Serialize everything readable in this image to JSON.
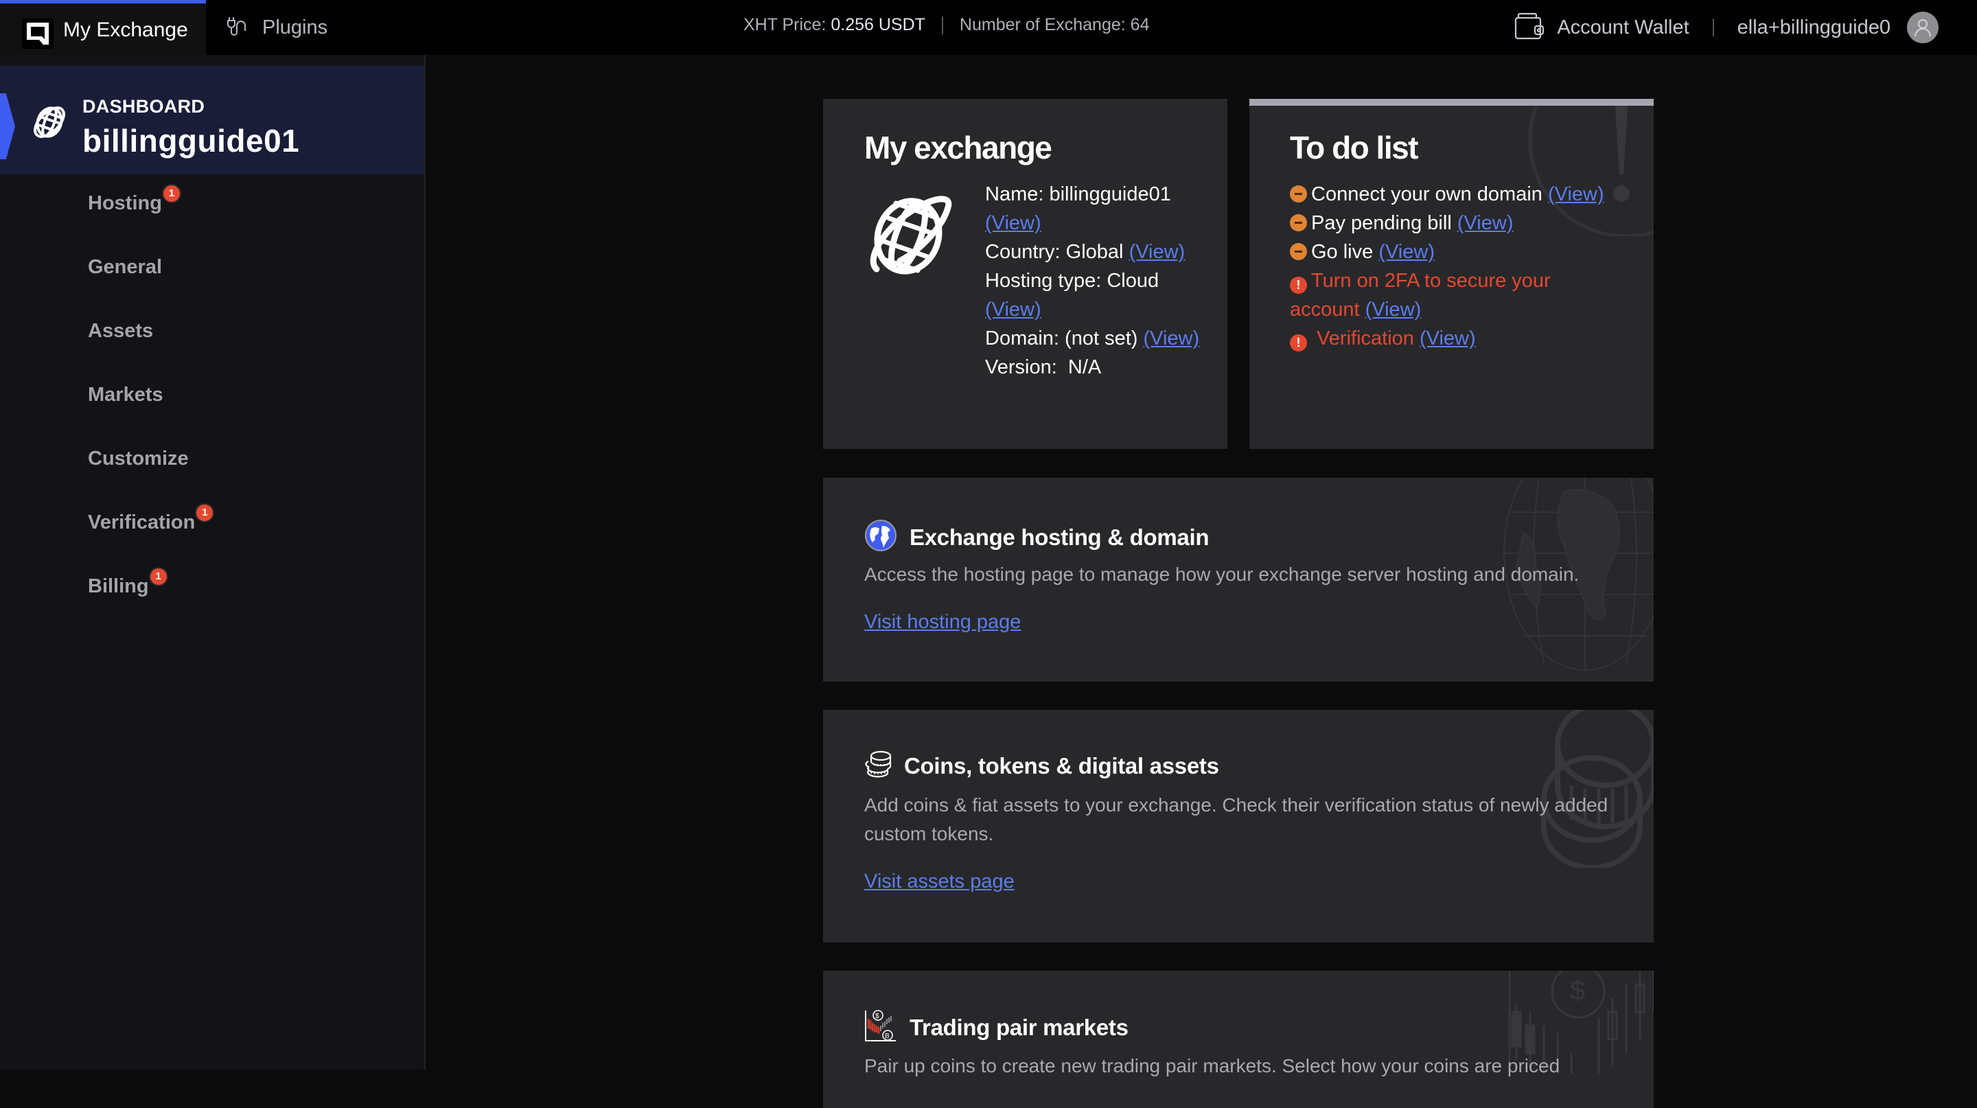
{
  "topbar": {
    "tabs": [
      {
        "label": "My Exchange",
        "icon": "exchange-logo-icon",
        "active": true
      },
      {
        "label": "Plugins",
        "icon": "plug-icon",
        "active": false
      }
    ],
    "xht_price_label": "XHT Price:",
    "xht_price_value": "0.256 USDT",
    "exchange_count_label": "Number of Exchange:",
    "exchange_count_value": "64",
    "wallet_label": "Account Wallet",
    "username": "ella+billingguide0"
  },
  "sidebar": {
    "header_kicker": "DASHBOARD",
    "header_title": "billingguide01",
    "items": [
      {
        "label": "Hosting",
        "badge": "1"
      },
      {
        "label": "General",
        "badge": null
      },
      {
        "label": "Assets",
        "badge": null
      },
      {
        "label": "Markets",
        "badge": null
      },
      {
        "label": "Customize",
        "badge": null
      },
      {
        "label": "Verification",
        "badge": "1"
      },
      {
        "label": "Billing",
        "badge": "1"
      }
    ]
  },
  "my_exchange": {
    "title": "My exchange",
    "name_label": "Name: billingguide01",
    "country_label": "Country: Global",
    "hosting_label": "Hosting type: Cloud",
    "domain_label": "Domain: (not set)",
    "version_label": "Version:  N/A",
    "view_link": "(View)"
  },
  "todo": {
    "title": "To do list",
    "items": [
      {
        "text": "Connect your own domain",
        "status": "pending",
        "link": "(View)"
      },
      {
        "text": "Pay pending bill",
        "status": "pending",
        "link": "(View)"
      },
      {
        "text": "Go live",
        "status": "pending",
        "link": "(View)"
      },
      {
        "text": "Turn on 2FA to secure your account",
        "status": "warning",
        "link": "(View)"
      },
      {
        "text": "Verification",
        "status": "warning",
        "link": "(View)"
      }
    ],
    "warning_glyph": "!"
  },
  "sections": [
    {
      "title": "Exchange hosting & domain",
      "description": "Access the hosting page to manage how your exchange server hosting and domain.",
      "link": "Visit hosting page"
    },
    {
      "title": "Coins, tokens & digital assets",
      "description": "Add coins & fiat assets to your exchange. Check their verification status of newly added custom tokens.",
      "link": "Visit assets page"
    },
    {
      "title": "Trading pair markets",
      "description": "Pair up coins to create new trading pair markets. Select how your coins are priced"
    }
  ],
  "colors": {
    "accent": "#3f5cf0",
    "link": "#5a7ef0",
    "pending": "#e08433",
    "warning": "#e5482f",
    "card_bg": "#28282b"
  }
}
